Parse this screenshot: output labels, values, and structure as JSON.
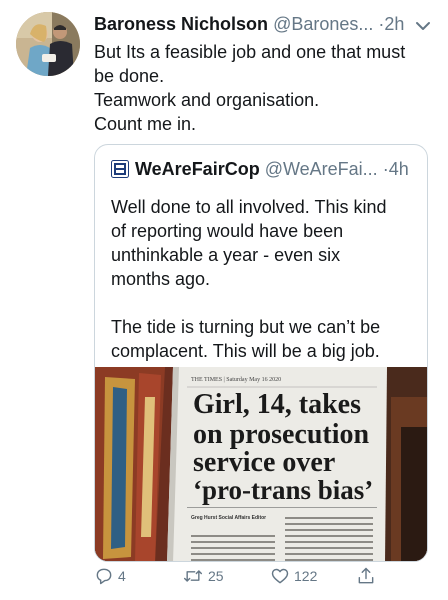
{
  "tweet": {
    "author_name": "Baroness Nicholson",
    "author_handle": "@Barones...",
    "separator": "·",
    "time": "2h",
    "lines": [
      "But Its a feasible job and one that must",
      "be done.",
      "Teamwork and organisation.",
      "Count me in."
    ]
  },
  "quoted": {
    "author_name": "WeAreFairCop",
    "author_handle": "@WeAreFai...",
    "separator": "·",
    "time": "4h",
    "lines": [
      "Well done to all involved. This kind",
      "of reporting would have been",
      "unthinkable a year - even six",
      "months ago.",
      "",
      "The tide is turning but we can’t be",
      "complacent. This will be a big job."
    ],
    "image": {
      "dateline": "THE TIMES | Saturday May 16 2020",
      "headline_lines": [
        "Girl, 14, takes",
        "on prosecution",
        "service over",
        "‘pro-trans bias’"
      ],
      "byline": "Greg Hurst Social Affairs Editor"
    }
  },
  "actions": {
    "reply_count": "4",
    "retweet_count": "25",
    "like_count": "122"
  },
  "colors": {
    "text": "#14171a",
    "secondary": "#657786",
    "border": "#ccd6dd"
  }
}
